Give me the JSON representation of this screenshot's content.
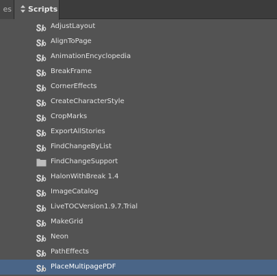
{
  "tabs": {
    "previous_label": "es",
    "active_label": "Scripts"
  },
  "items": [
    {
      "label": "AdjustLayout",
      "icon": "script-icon"
    },
    {
      "label": "AlignToPage",
      "icon": "script-icon"
    },
    {
      "label": "AnimationEncyclopedia",
      "icon": "script-icon"
    },
    {
      "label": "BreakFrame",
      "icon": "script-icon"
    },
    {
      "label": "CornerEffects",
      "icon": "script-icon"
    },
    {
      "label": "CreateCharacterStyle",
      "icon": "script-icon"
    },
    {
      "label": "CropMarks",
      "icon": "script-icon"
    },
    {
      "label": "ExportAllStories",
      "icon": "script-icon"
    },
    {
      "label": "FindChangeByList",
      "icon": "script-icon"
    },
    {
      "label": "FindChangeSupport",
      "icon": "folder-icon"
    },
    {
      "label": "HalonWithBreak 1.4",
      "icon": "script-icon"
    },
    {
      "label": "ImageCatalog",
      "icon": "script-icon"
    },
    {
      "label": "LiveTOCVersion1.9.7.Trial",
      "icon": "script-icon"
    },
    {
      "label": "MakeGrid",
      "icon": "script-icon"
    },
    {
      "label": "Neon",
      "icon": "script-icon"
    },
    {
      "label": "PathEffects",
      "icon": "script-icon"
    },
    {
      "label": "PlaceMultipagePDF",
      "icon": "script-icon",
      "selected": true
    }
  ],
  "colors": {
    "panel_bg": "#535353",
    "selection": "#4a6587",
    "text": "#e2e2e2"
  }
}
